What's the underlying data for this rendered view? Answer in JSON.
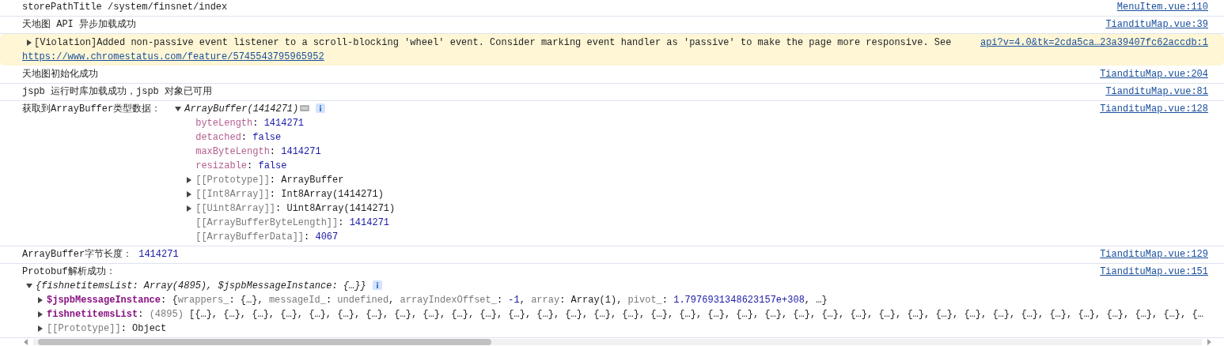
{
  "messages": [
    {
      "kind": "text",
      "text": "storePathTitle /system/finsnet/index",
      "source": "MenuItem.vue:110"
    },
    {
      "kind": "text",
      "text": "天地图 API 异步加载成功",
      "source": "TiandituMap.vue:39"
    },
    {
      "kind": "violation",
      "expanded": false,
      "text": "[Violation]Added non-passive event listener to a scroll-blocking 'wheel' event. Consider marking event handler as 'passive' to make the page more responsive. See",
      "link": "https://www.chromestatus.com/feature/5745543795965952",
      "source": "api?v=4.0&tk=2cda5ca…23a39407fc62accdb:1"
    },
    {
      "kind": "text",
      "text": "天地图初始化成功",
      "source": "TiandituMap.vue:204"
    },
    {
      "kind": "text",
      "text": "jspb 运行时库加载成功，jspb 对象已可用",
      "source": "TiandituMap.vue:81"
    },
    {
      "kind": "inline-object",
      "text": "获取到ArrayBuffer类型数据：",
      "source": "TiandituMap.vue:128",
      "object": {
        "header": "ArrayBuffer(1414271)",
        "expanded": true,
        "properties": [
          {
            "key": "byteLength",
            "kind": "accessor",
            "expandable": false,
            "value": [
              {
                "text": ": ",
                "kind": "plain"
              },
              {
                "text": "1414271",
                "kind": "number"
              }
            ]
          },
          {
            "key": "detached",
            "kind": "accessor",
            "expandable": false,
            "value": [
              {
                "text": ": ",
                "kind": "plain"
              },
              {
                "text": "false",
                "kind": "number"
              }
            ]
          },
          {
            "key": "maxByteLength",
            "kind": "accessor",
            "expandable": false,
            "value": [
              {
                "text": ": ",
                "kind": "plain"
              },
              {
                "text": "1414271",
                "kind": "number"
              }
            ]
          },
          {
            "key": "resizable",
            "kind": "accessor",
            "expandable": false,
            "value": [
              {
                "text": ": ",
                "kind": "plain"
              },
              {
                "text": "false",
                "kind": "number"
              }
            ]
          },
          {
            "key": "[[Prototype]]",
            "kind": "internal",
            "expandable": true,
            "expanded": false,
            "value": [
              {
                "text": ": ",
                "kind": "plain"
              },
              {
                "text": "ArrayBuffer",
                "kind": "plain"
              }
            ]
          },
          {
            "key": "[[Int8Array]]",
            "kind": "internal",
            "expandable": true,
            "expanded": false,
            "value": [
              {
                "text": ": ",
                "kind": "plain"
              },
              {
                "text": "Int8Array(1414271)",
                "kind": "plain"
              }
            ]
          },
          {
            "key": "[[Uint8Array]]",
            "kind": "internal",
            "expandable": true,
            "expanded": false,
            "value": [
              {
                "text": ": ",
                "kind": "plain"
              },
              {
                "text": "Uint8Array(1414271)",
                "kind": "plain"
              }
            ]
          },
          {
            "key": "[[ArrayBufferByteLength]]",
            "kind": "internal",
            "expandable": false,
            "value": [
              {
                "text": ": ",
                "kind": "plain"
              },
              {
                "text": "1414271",
                "kind": "number"
              }
            ]
          },
          {
            "key": "[[ArrayBufferData]]",
            "kind": "internal",
            "expandable": false,
            "value": [
              {
                "text": ": ",
                "kind": "plain"
              },
              {
                "text": "4067",
                "kind": "number"
              }
            ]
          }
        ]
      }
    },
    {
      "kind": "value",
      "text": "ArrayBuffer字节长度：",
      "value": "1414271",
      "source": "TiandituMap.vue:129"
    },
    {
      "kind": "object",
      "text": "Protobuf解析成功：",
      "source": "TiandituMap.vue:151",
      "object": {
        "header": "{fishnetitemsList: Array(4895), $jspbMessageInstance: {…}}",
        "expanded": true,
        "properties": [
          {
            "key": "$jspbMessageInstance",
            "kind": "own",
            "expandable": true,
            "expanded": false,
            "value": [
              {
                "text": ": {",
                "kind": "plain"
              },
              {
                "text": "wrappers_",
                "kind": "dim"
              },
              {
                "text": ": {…}, ",
                "kind": "plain"
              },
              {
                "text": "messageId_",
                "kind": "dim"
              },
              {
                "text": ": ",
                "kind": "plain"
              },
              {
                "text": "undefined",
                "kind": "dim"
              },
              {
                "text": ", ",
                "kind": "plain"
              },
              {
                "text": "arrayIndexOffset_",
                "kind": "dim"
              },
              {
                "text": ": ",
                "kind": "plain"
              },
              {
                "text": "-1",
                "kind": "number"
              },
              {
                "text": ", ",
                "kind": "plain"
              },
              {
                "text": "array",
                "kind": "dim"
              },
              {
                "text": ": Array(1), ",
                "kind": "plain"
              },
              {
                "text": "pivot_",
                "kind": "dim"
              },
              {
                "text": ": ",
                "kind": "plain"
              },
              {
                "text": "1.7976931348623157e+308",
                "kind": "number"
              },
              {
                "text": ", …}",
                "kind": "plain"
              }
            ]
          },
          {
            "key": "fishnetitemsList",
            "kind": "own",
            "expandable": true,
            "expanded": false,
            "value": [
              {
                "text": ": ",
                "kind": "plain"
              },
              {
                "text": "(4895)",
                "kind": "dim"
              },
              {
                "text": " [{…}, {…}, {…}, {…}, {…}, {…}, {…}, {…}, {…}, {…}, {…}, {…}, {…}, {…}, {…}, {…}, {…}, {…}, {…}, {…}, {…}, {…}, {…}, {…}, {…}, {…}, {…}, {…}, {…}, {…}, {…}, {…}, {…}, {…}, {…}, {…",
                "kind": "plain"
              }
            ]
          },
          {
            "key": "[[Prototype]]",
            "kind": "internal",
            "expandable": true,
            "expanded": false,
            "value": [
              {
                "text": ": ",
                "kind": "plain"
              },
              {
                "text": "Object",
                "kind": "plain"
              }
            ]
          }
        ]
      }
    }
  ]
}
